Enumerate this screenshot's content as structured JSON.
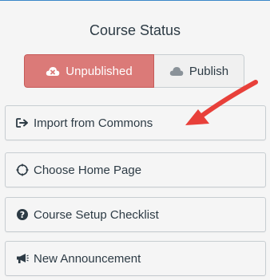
{
  "status_panel": {
    "title": "Course Status",
    "unpublished_label": "Unpublished",
    "publish_label": "Publish"
  },
  "actions": {
    "import_label": "Import from Commons",
    "home_page_label": "Choose Home Page",
    "checklist_label": "Course Setup Checklist",
    "announcement_label": "New Announcement"
  },
  "colors": {
    "unpublished_bg": "#db7a78",
    "accent_border": "#3a87c8",
    "arrow": "#e8403a"
  },
  "icons": {
    "unpublished": "cloud-x-icon",
    "publish": "cloud-icon",
    "import": "import-arrow-icon",
    "home_page": "target-icon",
    "checklist": "question-circle-icon",
    "announcement": "megaphone-icon"
  }
}
